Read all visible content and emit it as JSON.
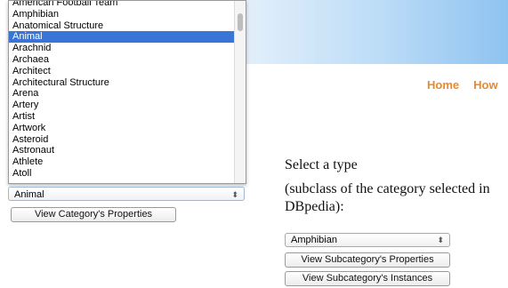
{
  "nav": {
    "home": "Home",
    "how": "How"
  },
  "category_listbox": {
    "items": [
      "American Football Team",
      "Amphibian",
      "Anatomical Structure",
      "Animal",
      "Arachnid",
      "Archaea",
      "Architect",
      "Architectural Structure",
      "Arena",
      "Artery",
      "Artist",
      "Artwork",
      "Asteroid",
      "Astronaut",
      "Athlete",
      "Atoll"
    ],
    "selected": "Animal"
  },
  "category_select": {
    "value": "Animal"
  },
  "buttons": {
    "category_properties": "View Category's Properties",
    "subcategory_properties": "View Subcategory's Properties",
    "subcategory_instances": "View Subcategory's Instances"
  },
  "type_section": {
    "title": "Select a type",
    "subtitle": "(subclass of the category selected in DBpedia):"
  },
  "subcategory_select": {
    "value": "Amphibian"
  },
  "colors": {
    "selected_bg": "#3875d7",
    "nav_link": "#e98a2b"
  }
}
